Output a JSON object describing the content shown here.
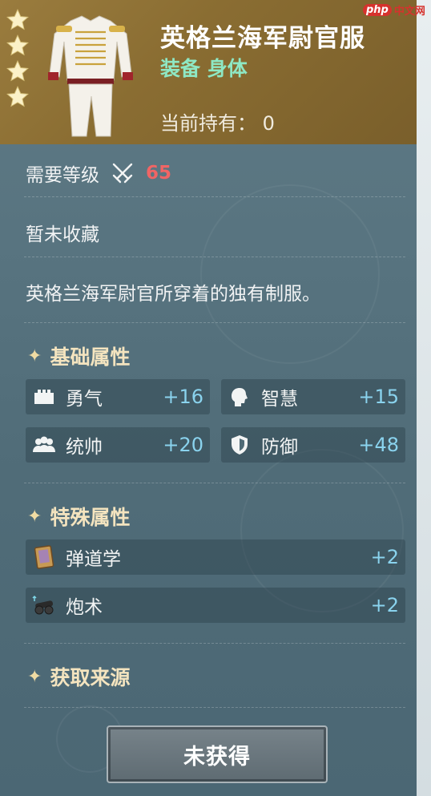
{
  "item": {
    "name": "英格兰海军尉官服",
    "type": "装备 身体",
    "owned_label": "当前持有：",
    "owned_count": "0",
    "star_count": 4
  },
  "watermark": {
    "badge": "php",
    "text": "中文网"
  },
  "requirement": {
    "label": "需要等级",
    "level": "65",
    "icon": "crossed-swords-icon"
  },
  "collection_status": "暂未收藏",
  "description": "英格兰海军尉官所穿着的独有制服。",
  "base_attributes": {
    "title": "基础属性",
    "items": [
      {
        "label": "勇气",
        "value": "+16",
        "icon": "courage-icon"
      },
      {
        "label": "智慧",
        "value": "+15",
        "icon": "head-icon"
      },
      {
        "label": "统帅",
        "value": "+20",
        "icon": "people-icon"
      },
      {
        "label": "防御",
        "value": "+48",
        "icon": "shield-icon"
      }
    ]
  },
  "special_attributes": {
    "title": "特殊属性",
    "items": [
      {
        "label": "弹道学",
        "value": "+2",
        "icon": "book-icon"
      },
      {
        "label": "炮术",
        "value": "+2",
        "icon": "cannon-icon"
      }
    ]
  },
  "source": {
    "title": "获取来源"
  },
  "button": {
    "label": "未获得"
  },
  "colors": {
    "title_accent": "#8ee8c4",
    "level": "#f06565",
    "attr_value": "#8ad3ee",
    "section": "#f4e4bf"
  }
}
